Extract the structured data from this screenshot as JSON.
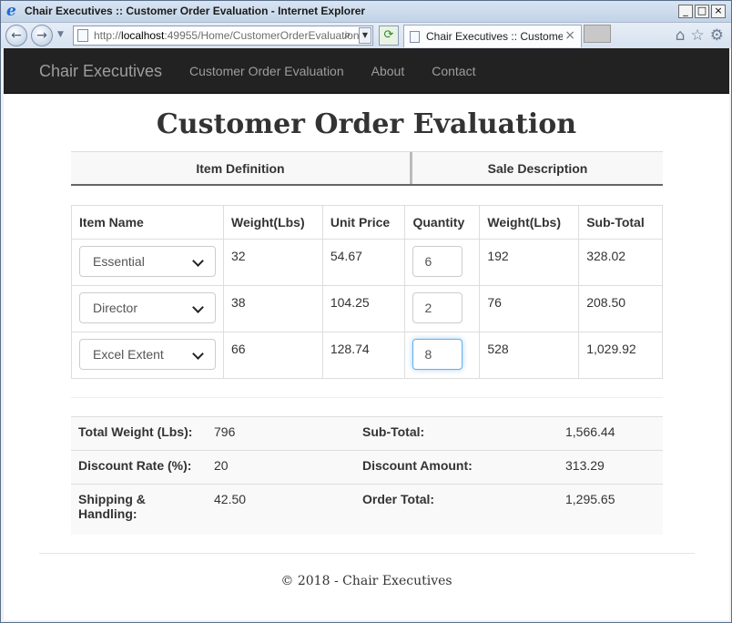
{
  "window": {
    "title": "Chair Executives :: Customer Order Evaluation - Internet Explorer",
    "min_glyph": "_",
    "max_glyph": "□",
    "close_glyph": "×"
  },
  "browser": {
    "url_prefix": "http://",
    "url_host": "localhost",
    "url_rest": ":49955/Home/CustomerOrderEvaluation",
    "tab_title": "Chair Executives :: Custome...",
    "tab_close": "×",
    "icons": [
      "back-icon",
      "forward-icon",
      "refresh-icon",
      "home-icon",
      "favorites-star-icon",
      "settings-gear-icon"
    ]
  },
  "navbar": {
    "brand": "Chair Executives",
    "links": [
      "Customer Order Evaluation",
      "About",
      "Contact"
    ]
  },
  "page": {
    "title": "Customer Order Evaluation",
    "sections": [
      "Item Definition",
      "Sale Description"
    ]
  },
  "table": {
    "headers": [
      "Item Name",
      "Weight(Lbs)",
      "Unit Price",
      "Quantity",
      "Weight(Lbs)",
      "Sub-Total"
    ],
    "rows": [
      {
        "item": "Essential",
        "weight": "32",
        "unit_price": "54.67",
        "quantity": "6",
        "total_weight": "192",
        "subtotal": "328.02"
      },
      {
        "item": "Director",
        "weight": "38",
        "unit_price": "104.25",
        "quantity": "2",
        "total_weight": "76",
        "subtotal": "208.50"
      },
      {
        "item": "Excel Extent",
        "weight": "66",
        "unit_price": "128.74",
        "quantity": "8",
        "total_weight": "528",
        "subtotal": "1,029.92"
      }
    ]
  },
  "summary": {
    "total_weight_label": "Total Weight (Lbs):",
    "total_weight": "796",
    "subtotal_label": "Sub-Total:",
    "subtotal": "1,566.44",
    "discount_rate_label": "Discount Rate (%):",
    "discount_rate": "20",
    "discount_amount_label": "Discount Amount:",
    "discount_amount": "313.29",
    "shipping_label_1": "Shipping &",
    "shipping_label_2": "Handling:",
    "shipping": "42.50",
    "order_total_label": "Order Total:",
    "order_total": "1,295.65"
  },
  "footer": {
    "text": "© 2018 - Chair Executives"
  },
  "colors": {
    "navbar_bg": "#222222",
    "navbar_text": "#9d9d9d",
    "focus_border": "#66afe9"
  }
}
